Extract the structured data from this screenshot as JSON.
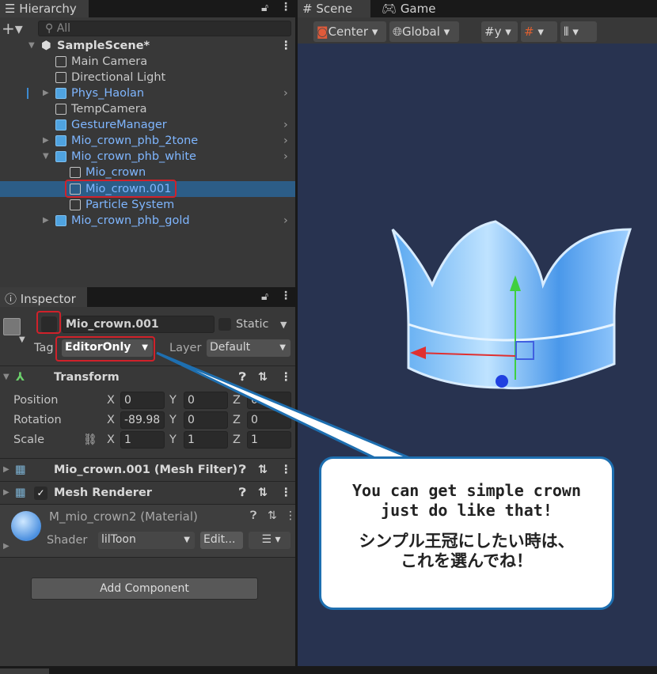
{
  "hierarchy": {
    "tab": "Hierarchy",
    "search_placeholder": "All",
    "items": [
      {
        "label": "SampleScene*"
      },
      {
        "label": "Main Camera"
      },
      {
        "label": "Directional Light"
      },
      {
        "label": "Phys_Haolan"
      },
      {
        "label": "TempCamera"
      },
      {
        "label": "GestureManager"
      },
      {
        "label": "Mio_crown_phb_2tone"
      },
      {
        "label": "Mio_crown_phb_white"
      },
      {
        "label": "Mio_crown"
      },
      {
        "label": "Mio_crown.001"
      },
      {
        "label": "Particle System"
      },
      {
        "label": "Mio_crown_phb_gold"
      }
    ]
  },
  "inspector": {
    "tab": "Inspector",
    "name": "Mio_crown.001",
    "static_label": "Static",
    "active": false,
    "tag_label": "Tag",
    "tag_value": "EditorOnly",
    "layer_label": "Layer",
    "layer_value": "Default",
    "transform": {
      "title": "Transform",
      "position": {
        "label": "Position",
        "x": "0",
        "y": "0",
        "z": "0"
      },
      "rotation": {
        "label": "Rotation",
        "x": "-89.98",
        "y": "0",
        "z": "0"
      },
      "scale": {
        "label": "Scale",
        "x": "1",
        "y": "1",
        "z": "1"
      },
      "axis": {
        "x": "X",
        "y": "Y",
        "z": "Z"
      }
    },
    "mesh_filter": {
      "title": "Mio_crown.001 (Mesh Filter)"
    },
    "mesh_renderer": {
      "title": "Mesh Renderer",
      "enabled": true
    },
    "material": {
      "title": "M_mio_crown2 (Material)",
      "shader_label": "Shader",
      "shader_value": "lilToon",
      "edit_label": "Edit..."
    },
    "add_component": "Add Component"
  },
  "scene": {
    "tabs": [
      {
        "label": "Scene"
      },
      {
        "label": "Game"
      }
    ],
    "pivot": "Center",
    "space": "Global"
  },
  "callout": {
    "line1": "You can get simple crown",
    "line2": "just do like that!",
    "line3": "シンプル王冠にしたい時は、",
    "line4": "これを選んでね！",
    "border": "#1e6fb0"
  }
}
